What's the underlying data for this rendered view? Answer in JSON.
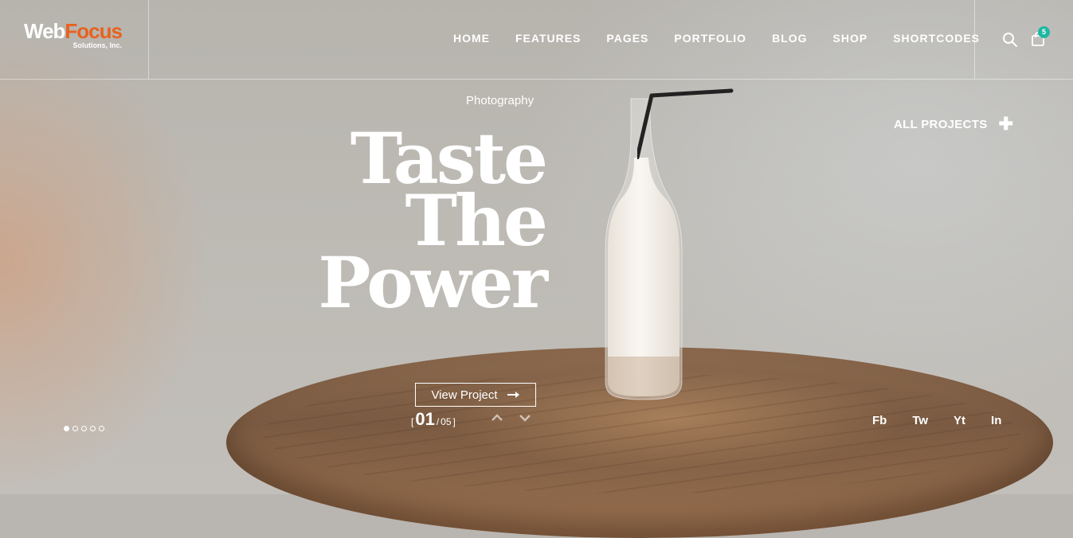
{
  "brand": {
    "logo_main_a": "Web",
    "logo_main_b": "Focus",
    "logo_sub": "Solutions, Inc.",
    "accent_color": "#e8621f"
  },
  "nav": {
    "items": [
      {
        "label": "HOME"
      },
      {
        "label": "FEATURES"
      },
      {
        "label": "PAGES"
      },
      {
        "label": "PORTFOLIO"
      },
      {
        "label": "BLOG"
      },
      {
        "label": "SHOP"
      },
      {
        "label": "SHORTCODES"
      }
    ]
  },
  "header_actions": {
    "search_icon": "search-icon",
    "cart_icon": "shopping-bag-icon",
    "cart_count": "5",
    "badge_color": "#1fb7a4"
  },
  "hero": {
    "category": "Photography",
    "title_lines": [
      "Taste",
      "The",
      "Power"
    ],
    "cta_label": "View Project",
    "cta_icon": "arrow-right-icon",
    "all_projects_label": "ALL PROJECTS",
    "all_projects_icon": "plus-icon"
  },
  "slider": {
    "bracket_open": "[",
    "current": "01",
    "separator": "/",
    "total": "05",
    "bracket_close": "]",
    "prev_icon": "chevron-up-icon",
    "next_icon": "chevron-down-icon",
    "dots_count": 5,
    "active_dot": 0
  },
  "social": {
    "items": [
      {
        "label": "Fb"
      },
      {
        "label": "Tw"
      },
      {
        "label": "Yt"
      },
      {
        "label": "In"
      }
    ]
  }
}
